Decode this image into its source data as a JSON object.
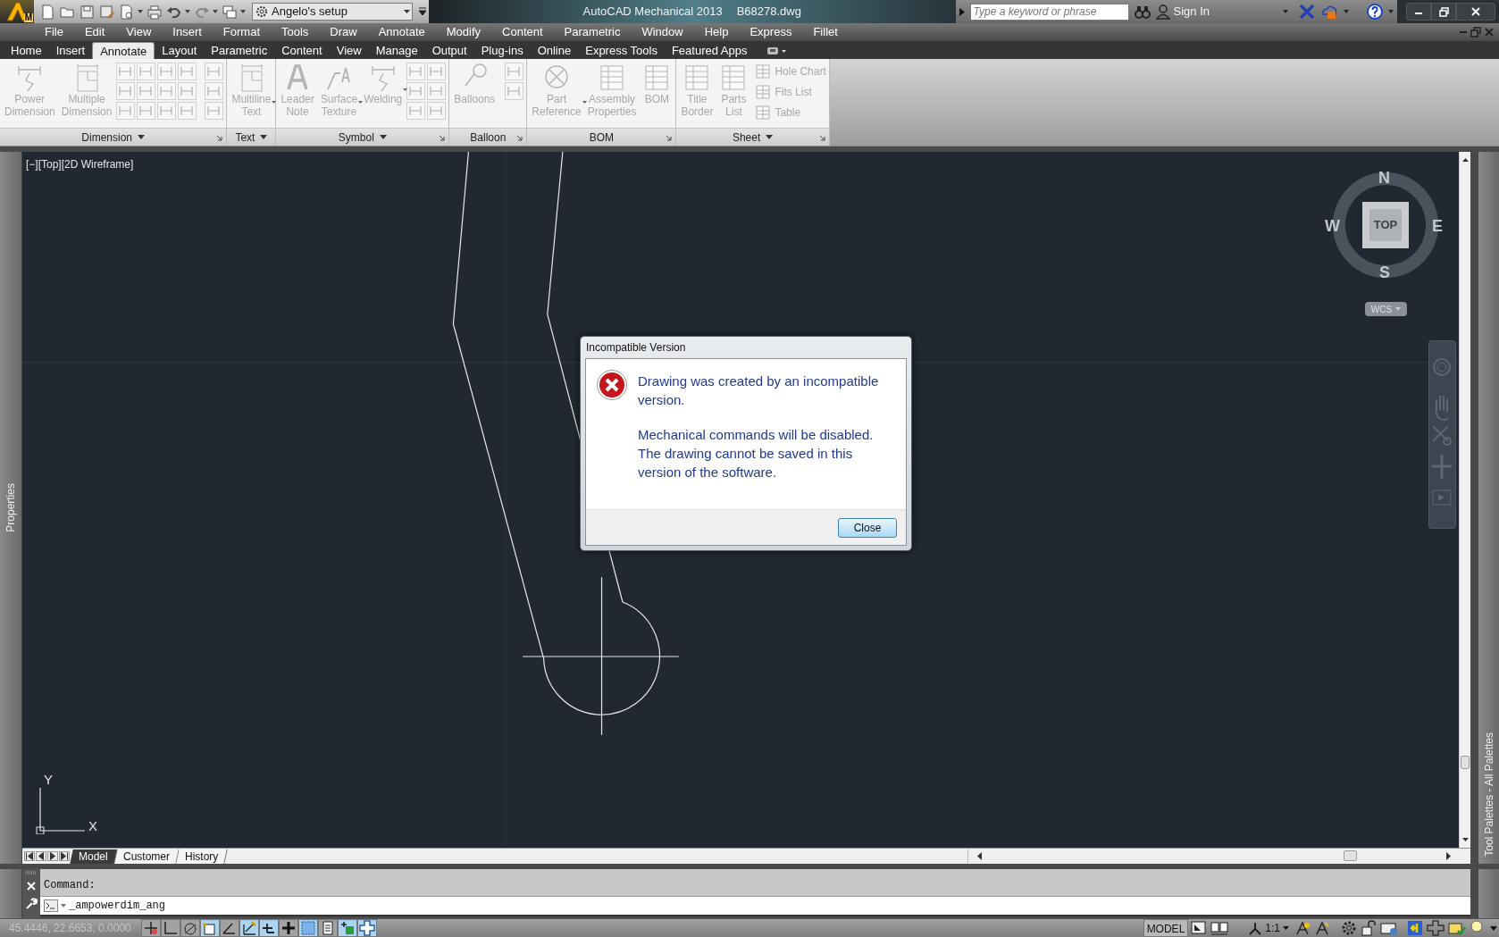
{
  "title_bar": {
    "app_badge": "M",
    "workspace": "Angelo's setup",
    "app_title": "AutoCAD Mechanical 2013",
    "file_name": "B68278.dwg",
    "search": {
      "placeholder": "Type a keyword or phrase"
    },
    "sign_in": "Sign In"
  },
  "menu_bar": [
    "File",
    "Edit",
    "View",
    "Insert",
    "Format",
    "Tools",
    "Draw",
    "Annotate",
    "Modify",
    "Content",
    "Parametric",
    "Window",
    "Help",
    "Express",
    "Fillet"
  ],
  "ribbon_tabs": [
    {
      "label": "Home",
      "selected": false
    },
    {
      "label": "Insert",
      "selected": false
    },
    {
      "label": "Annotate",
      "selected": true
    },
    {
      "label": "Layout",
      "selected": false
    },
    {
      "label": "Parametric",
      "selected": false
    },
    {
      "label": "Content",
      "selected": false
    },
    {
      "label": "View",
      "selected": false
    },
    {
      "label": "Manage",
      "selected": false
    },
    {
      "label": "Output",
      "selected": false
    },
    {
      "label": "Plug-ins",
      "selected": false
    },
    {
      "label": "Online",
      "selected": false
    },
    {
      "label": "Express Tools",
      "selected": false
    },
    {
      "label": "Featured Apps",
      "selected": false
    }
  ],
  "ribbon_panels": [
    {
      "title": "Dimension",
      "menu": true,
      "launcher": true,
      "tools": [
        {
          "kind": "large",
          "label": "Power\nDimension",
          "dropdown": false,
          "disabled": true
        },
        {
          "kind": "large",
          "label": "Multiple\nDimension",
          "dropdown": false,
          "disabled": true
        },
        {
          "kind": "icon-grid",
          "disabled": true
        },
        {
          "kind": "icon-column",
          "disabled": true
        }
      ]
    },
    {
      "title": "Text",
      "menu": true,
      "launcher": false,
      "tools": [
        {
          "kind": "large",
          "label": "Multiline\nText",
          "dropdown": true,
          "disabled": true
        }
      ]
    },
    {
      "title": "Symbol",
      "menu": true,
      "launcher": true,
      "tools": [
        {
          "kind": "large",
          "label": "Leader\nNote",
          "dropdown": false,
          "disabled": true
        },
        {
          "kind": "large",
          "label": "Surface\nTexture",
          "dropdown": true,
          "disabled": true
        },
        {
          "kind": "large",
          "label": "Welding",
          "dropdown": true,
          "disabled": true
        },
        {
          "kind": "icon-pair",
          "disabled": true
        }
      ]
    },
    {
      "title": "Balloon",
      "menu": false,
      "launcher": true,
      "tools": [
        {
          "kind": "large",
          "label": "Balloons",
          "dropdown": false,
          "disabled": true
        },
        {
          "kind": "icon-column-short",
          "disabled": true
        }
      ]
    },
    {
      "title": "BOM",
      "menu": false,
      "launcher": true,
      "tools": [
        {
          "kind": "large",
          "label": "Part\nReference",
          "dropdown": true,
          "disabled": true
        },
        {
          "kind": "large",
          "label": "Assembly\nProperties",
          "dropdown": false,
          "disabled": true
        },
        {
          "kind": "large",
          "label": "BOM",
          "dropdown": false,
          "disabled": true
        }
      ]
    },
    {
      "title": "Sheet",
      "menu": true,
      "launcher": true,
      "tools": [
        {
          "kind": "large",
          "label": "Title\nBorder",
          "dropdown": false,
          "disabled": true
        },
        {
          "kind": "large",
          "label": "Parts\nList",
          "dropdown": false,
          "disabled": true
        },
        {
          "kind": "small-list",
          "items": [
            {
              "label": "Hole Chart",
              "disabled": true
            },
            {
              "label": "Fits List",
              "disabled": true
            },
            {
              "label": "Table",
              "disabled": true
            }
          ]
        }
      ]
    }
  ],
  "palettes": {
    "left": "Properties",
    "right": "Tool Palettes - All Palettes"
  },
  "viewport": {
    "label": "[−][Top][2D Wireframe]",
    "viewcube": {
      "north": "N",
      "south": "S",
      "east": "E",
      "west": "W",
      "face": "TOP",
      "coordinate_system": "WCS"
    },
    "ucs": {
      "x_label": "X",
      "y_label": "Y"
    }
  },
  "dialog": {
    "title": "Incompatible Version",
    "message": "Drawing was created by an incompatible version.",
    "details": "Mechanical commands will be disabled. The drawing cannot be saved in this version of the software.",
    "button": "Close"
  },
  "layout_tabs": [
    {
      "label": "Model",
      "selected": true
    },
    {
      "label": "Customer",
      "selected": false
    },
    {
      "label": "History",
      "selected": false
    }
  ],
  "command_line": {
    "history": "Command:",
    "input": "_ampowerdim_ang"
  },
  "status_bar": {
    "coordinates": "45.4446, 22.6653, 0.0000",
    "toggles": [
      {
        "on": false
      },
      {
        "on": false
      },
      {
        "on": false
      },
      {
        "on": true
      },
      {
        "on": false
      },
      {
        "on": true
      },
      {
        "on": true
      },
      {
        "on": false
      },
      {
        "on": true
      },
      {
        "on": false
      },
      {
        "on": true
      },
      {
        "on": true
      }
    ],
    "space": "MODEL",
    "scale": "1:1"
  }
}
